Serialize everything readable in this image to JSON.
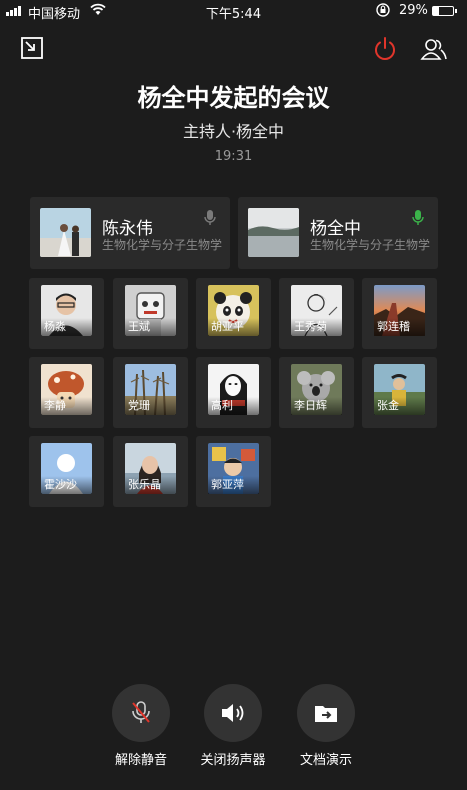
{
  "status_bar": {
    "carrier": "中国移动",
    "time": "下午5:44",
    "battery": "29%",
    "battery_level": 0.29
  },
  "header": {
    "title": "杨全中发起的会议",
    "host": "主持人·杨全中",
    "duration": "19:31"
  },
  "main_speakers": [
    {
      "name": "陈永伟",
      "org": "生物化学与分子生物学",
      "mic_color": "#7a7a7a",
      "avatar": "wedding-photo"
    },
    {
      "name": "杨全中",
      "org": "生物化学与分子生物学",
      "mic_color": "#3bb34a",
      "avatar": "lake-photo"
    }
  ],
  "participants": [
    {
      "name": "杨淼",
      "avatar": "person-glasses"
    },
    {
      "name": "王斌",
      "avatar": "cartoon-robot"
    },
    {
      "name": "胡亚平",
      "avatar": "panda"
    },
    {
      "name": "王秀菊",
      "avatar": "girl-sketch"
    },
    {
      "name": "郭连稽",
      "avatar": "sunset"
    },
    {
      "name": "李静",
      "avatar": "mushroom-cartoon"
    },
    {
      "name": "党珊",
      "avatar": "trees"
    },
    {
      "name": "高利",
      "avatar": "no-face"
    },
    {
      "name": "李日辉",
      "avatar": "koala"
    },
    {
      "name": "张金",
      "avatar": "person-outdoor"
    },
    {
      "name": "霍沙沙",
      "avatar": "default-avatar"
    },
    {
      "name": "张乐晶",
      "avatar": "woman-photo"
    },
    {
      "name": "郭亚萍",
      "avatar": "child-photo"
    }
  ],
  "controls": {
    "unmute_label": "解除静音",
    "speaker_label": "关闭扬声器",
    "share_label": "文档演示"
  },
  "colors": {
    "background": "#1c1c1c",
    "card": "#2a2a2a",
    "end_button": "#e0352b",
    "mic_active": "#3bb34a",
    "mute_slash": "#e0352b"
  }
}
